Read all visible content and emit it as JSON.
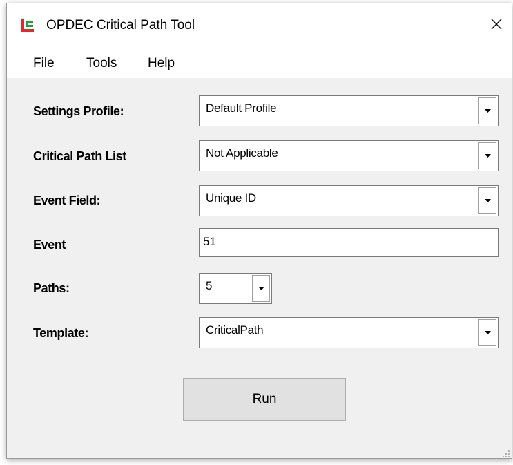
{
  "window": {
    "title": "OPDEC Critical Path Tool",
    "close_icon": "close-icon",
    "app_icon": "opdec-logo-icon"
  },
  "menu": {
    "items": [
      "File",
      "Tools",
      "Help"
    ]
  },
  "form": {
    "settings_profile": {
      "label": "Settings Profile:",
      "value": "Default Profile"
    },
    "critical_path_list": {
      "label": "Critical Path List",
      "value": "Not Applicable"
    },
    "event_field": {
      "label": "Event Field:",
      "value": "Unique ID"
    },
    "event": {
      "label": "Event",
      "value": "51"
    },
    "paths": {
      "label": "Paths:",
      "value": "5"
    },
    "template": {
      "label": "Template:",
      "value": "CriticalPath"
    }
  },
  "run_button": {
    "label": "Run"
  },
  "colors": {
    "window_bg": "#f0f0f0",
    "icon_red": "#e8262a",
    "icon_green": "#1f9e3a"
  }
}
